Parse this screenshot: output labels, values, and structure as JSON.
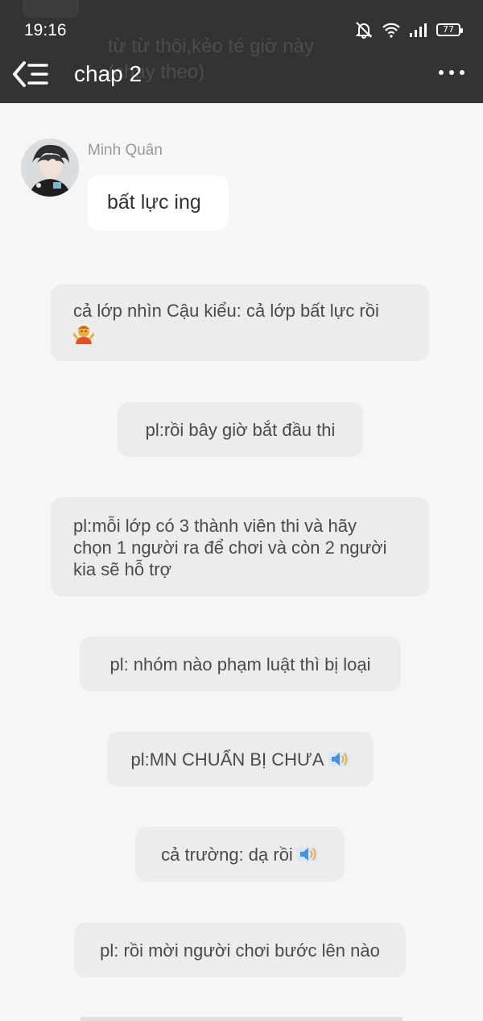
{
  "status_bar": {
    "time": "19:16",
    "battery": "77"
  },
  "background_text": {
    "line1": "từ từ thôi,kẻo té giờ này",
    "line2": "(chạy theo)"
  },
  "header": {
    "title": "chap 2"
  },
  "messages": {
    "sender_name": "Minh Quân",
    "user_message": "bất lực ing",
    "sys1": "cả lớp nhìn Cậu kiểu: cả lớp bất lực rồi",
    "sys2": "pl:rồi bây giờ bắt đầu thi",
    "sys3_line1": "pl:mỗi lớp có 3 thành viên thi và hãy",
    "sys3_line2": "chọn 1 người ra để chơi và còn 2 người",
    "sys3_line3": "kia sẽ hỗ trợ",
    "sys4": "pl: nhóm nào phạm luật thì bị loại",
    "sys5": "pl:MN CHUẨN BỊ CHƯA",
    "sys6": "cả trường: dạ rồi",
    "sys7": "pl: rồi mời người chơi bước lên nào"
  },
  "icons": {
    "back": "back-list-icon",
    "more": "more-dots-icon",
    "speaker": "speaker-icon",
    "shrug": "person-shrugging-emoji"
  },
  "colors": {
    "header_bg": "#333333",
    "page_bg": "#f6f6f6",
    "bubble_bg": "#ececec",
    "shrug_emoji": "#f2a93b",
    "speaker_icon": "#4a90d9"
  }
}
